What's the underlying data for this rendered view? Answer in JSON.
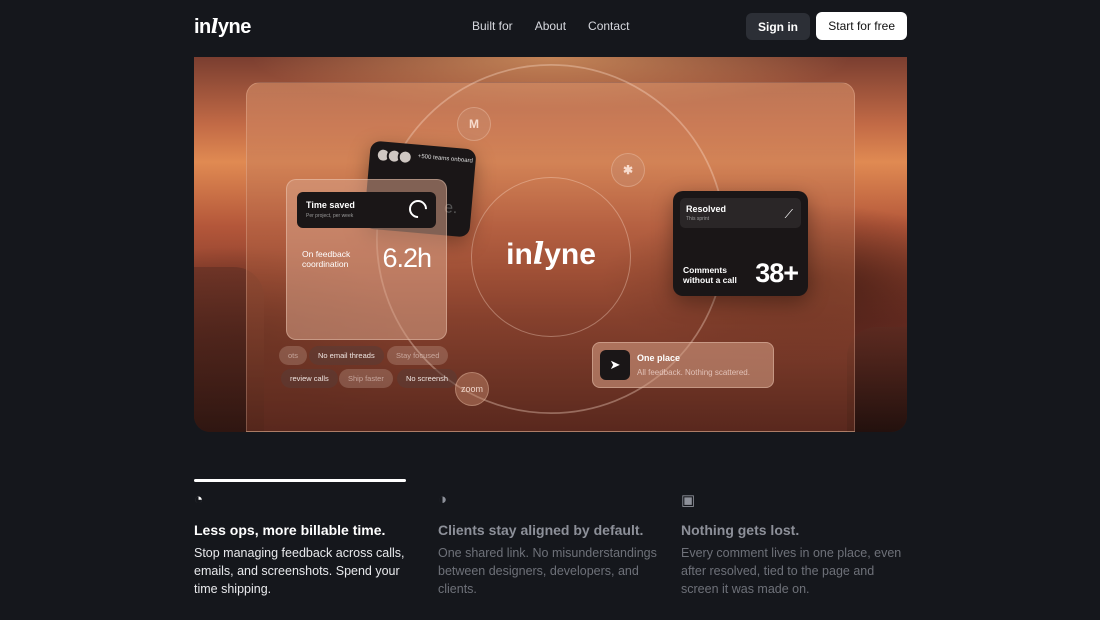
{
  "nav": {
    "logo": "inlyne",
    "links": [
      "Built for",
      "About",
      "Contact"
    ],
    "signin": "Sign in",
    "start": "Start for free"
  },
  "hero": {
    "center_logo": "inlyne",
    "integrations": [
      "gmail-icon",
      "slack-icon",
      "zoom"
    ],
    "zoom_label": "zoom",
    "onboard_text": "+500 teams onboard",
    "time_card": {
      "title": "Time saved",
      "subtitle": "Per project, per week",
      "label": "On feedback coordination",
      "value": "6.2h",
      "pills_row1": [
        "ots",
        "No email threads",
        "Stay focused"
      ],
      "pills_row2": [
        "review calls",
        "Ship faster",
        "No screensh"
      ]
    },
    "resolved_card": {
      "title": "Resolved",
      "subtitle": "This sprint",
      "label": "Comments without a call",
      "value": "38+"
    },
    "oneplace_card": {
      "title": "One place",
      "subtitle": "All feedback. Nothing scattered."
    }
  },
  "features": {
    "progress": 1.0,
    "items": [
      {
        "icon": "clock-icon",
        "title": "Less ops, more billable time.",
        "text": "Stop managing feedback across calls, emails, and screenshots. Spend your time shipping."
      },
      {
        "icon": "overlap-circles-icon",
        "title": "Clients stay aligned by default.",
        "text": "One shared link. No misunderstandings between designers, developers, and clients."
      },
      {
        "icon": "comment-check-icon",
        "title": "Nothing gets lost.",
        "text": "Every comment lives in one place, even after resolved, tied to the page and screen it was made on."
      }
    ]
  }
}
